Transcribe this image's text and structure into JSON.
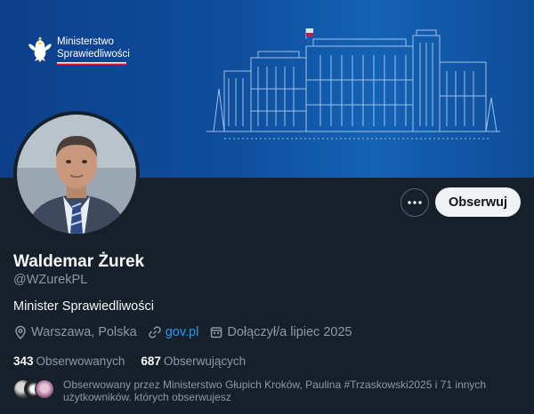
{
  "banner": {
    "logo_line1": "Ministerstwo",
    "logo_line2": "Sprawiedliwości",
    "colors": {
      "banner": "#0f4f9e",
      "flag_white": "#ffffff",
      "flag_red": "#dc143c"
    }
  },
  "actions": {
    "more_label": "More",
    "follow_label": "Obserwuj"
  },
  "profile": {
    "name": "Waldemar Żurek",
    "handle": "@WZurekPL",
    "bio": "Minister Sprawiedliwości",
    "location": "Warszawa, Polska",
    "website": "gov.pl",
    "joined": "Dołączył/a lipiec 2025"
  },
  "stats": {
    "following_count": "343",
    "following_label": "Obserwowanych",
    "followers_count": "687",
    "followers_label": "Obserwujących"
  },
  "followed_by": {
    "text": "Obserwowany przez Ministerstwo Głupich Kroków, Paulina #Trzaskowski2025 i 71 innych użytkowników. których obserwujesz"
  },
  "icons": {
    "logo": "eagle-icon",
    "location": "map-pin-icon",
    "link": "link-icon",
    "joined": "calendar-icon",
    "more": "more-horizontal-icon"
  },
  "colors": {
    "background": "#15202b",
    "text_primary": "#f7f9f9",
    "text_secondary": "#8b98a5",
    "link": "#1d9bf0",
    "follow_button_bg": "#eff3f4"
  }
}
